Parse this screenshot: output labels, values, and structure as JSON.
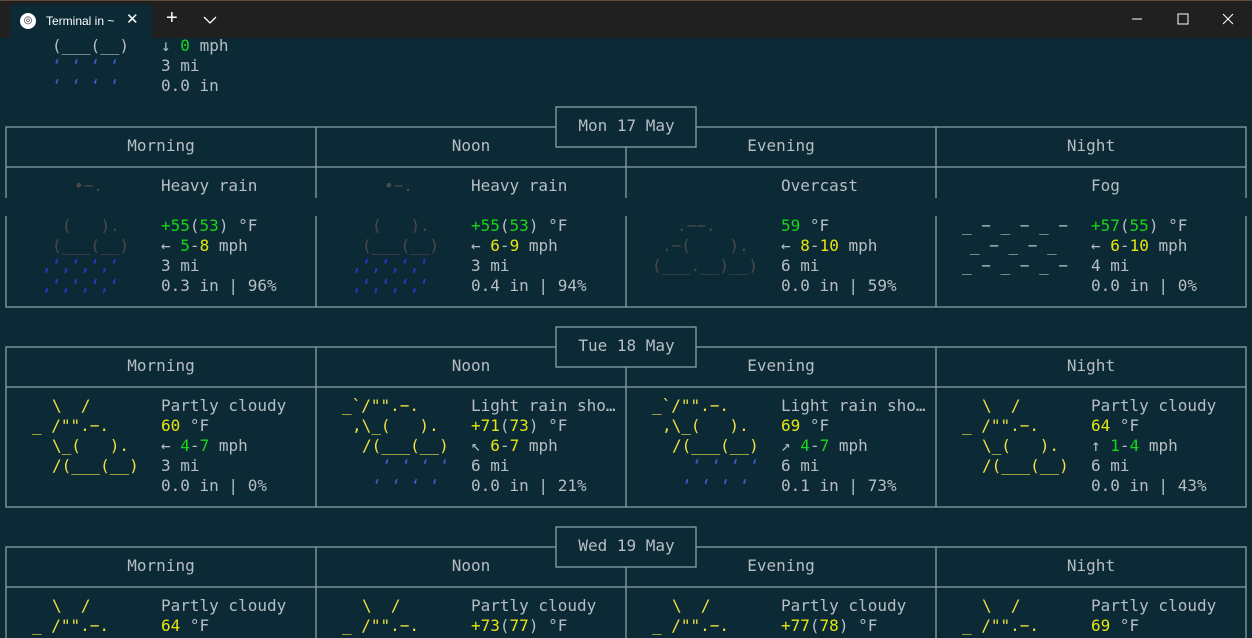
{
  "tab": {
    "title": "Terminal in ~",
    "icon": "tux-icon"
  },
  "top": {
    "art": [
      "(___(__)",
      "‘ ‘ ‘ ‘",
      "‘ ‘ ‘ ‘"
    ],
    "wind_arrow": "↓",
    "wind_speed": "0",
    "wind_unit": "mph",
    "visibility": "3 mi",
    "precip": "0.0 in"
  },
  "days": [
    {
      "date": "Mon 17 May",
      "periods": [
        {
          "name": "Morning",
          "condition": "Heavy rain",
          "art": [
            "•−.",
            "(   ).",
            "(___(__)",
            "‚ʻ‚ʻ‚ʻ‚ʻ",
            "‚ʻ‚ʻ‚ʻ‚ʻ"
          ],
          "temp": "+55",
          "temp2": "53",
          "temp_unit": "°F",
          "wind_arrow": "←",
          "wind_from": "5",
          "wind_to": "8",
          "wind_unit": "mph",
          "visibility": "3 mi",
          "precip": "0.3 in | 96%"
        },
        {
          "name": "Noon",
          "condition": "Heavy rain",
          "art": [
            "•−.",
            "(   ).",
            "(___(__)",
            "‚ʻ‚ʻ‚ʻ‚ʻ",
            "‚ʻ‚ʻ‚ʻ‚ʻ"
          ],
          "temp": "+55",
          "temp2": "53",
          "temp_unit": "°F",
          "wind_arrow": "←",
          "wind_from": "6",
          "wind_to": "9",
          "wind_unit": "mph",
          "visibility": "3 mi",
          "precip": "0.4 in | 94%"
        },
        {
          "name": "Evening",
          "condition": "Overcast",
          "art": [
            "",
            ".−−.",
            ".−(    ).",
            "(___.__)__)"
          ],
          "temp": "59",
          "temp2": "",
          "temp_unit": "°F",
          "wind_arrow": "←",
          "wind_from": "8",
          "wind_to": "10",
          "wind_unit": "mph",
          "visibility": "6 mi",
          "precip": "0.0 in | 59%"
        },
        {
          "name": "Night",
          "condition": "Fog",
          "art": [
            "_ − _ − _ −",
            "_ − _ − _",
            "_ − _ − _ −"
          ],
          "temp": "+57",
          "temp2": "55",
          "temp_unit": "°F",
          "wind_arrow": "←",
          "wind_from": "6",
          "wind_to": "10",
          "wind_unit": "mph",
          "visibility": "4 mi",
          "precip": "0.0 in | 0%"
        }
      ]
    },
    {
      "date": "Tue 18 May",
      "periods": [
        {
          "name": "Morning",
          "condition": "Partly cloudy",
          "art": [
            "\\  /",
            "_ /\"\".−.",
            "\\_(   ).",
            "/(___(__)"
          ],
          "temp": "60",
          "temp2": "",
          "temp_unit": "°F",
          "wind_arrow": "←",
          "wind_from": "4",
          "wind_to": "7",
          "wind_unit": "mph",
          "visibility": "3 mi",
          "precip": "0.0 in | 0%"
        },
        {
          "name": "Noon",
          "condition": "Light rain sho…",
          "art": [
            "_`/\"\".−.",
            ",\\_(   ).",
            "/(___(__)",
            "‘ ‘ ‘ ‘",
            "‘ ‘ ‘ ‘"
          ],
          "temp": "+71",
          "temp2": "73",
          "temp_unit": "°F",
          "wind_arrow": "↖",
          "wind_from": "6",
          "wind_to": "7",
          "wind_unit": "mph",
          "visibility": "6 mi",
          "precip": "0.0 in | 21%"
        },
        {
          "name": "Evening",
          "condition": "Light rain sho…",
          "art": [
            "_`/\"\".−.",
            ",\\_(   ).",
            "/(___(__)",
            "‘ ‘ ‘ ‘",
            "‘ ‘ ‘ ‘"
          ],
          "temp": "69",
          "temp2": "",
          "temp_unit": "°F",
          "wind_arrow": "↗",
          "wind_from": "4",
          "wind_to": "7",
          "wind_unit": "mph",
          "visibility": "6 mi",
          "precip": "0.1 in | 73%"
        },
        {
          "name": "Night",
          "condition": "Partly cloudy",
          "art": [
            "\\  /",
            "_ /\"\".−.",
            "\\_(   ).",
            "/(___(__)"
          ],
          "temp": "64",
          "temp2": "",
          "temp_unit": "°F",
          "wind_arrow": "↑",
          "wind_from": "1",
          "wind_to": "4",
          "wind_unit": "mph",
          "visibility": "6 mi",
          "precip": "0.0 in | 43%"
        }
      ]
    },
    {
      "date": "Wed 19 May",
      "periods": [
        {
          "name": "Morning",
          "condition": "Partly cloudy",
          "art": [
            "\\  /",
            "_ /\"\".−."
          ],
          "temp": "64",
          "temp2": "",
          "temp_unit": "°F"
        },
        {
          "name": "Noon",
          "condition": "Partly cloudy",
          "art": [
            "\\  /",
            "_ /\"\".−."
          ],
          "temp": "+73",
          "temp2": "77",
          "temp_unit": "°F"
        },
        {
          "name": "Evening",
          "condition": "Partly cloudy",
          "art": [
            "\\  /",
            "_ /\"\".−."
          ],
          "temp": "+77",
          "temp2": "78",
          "temp_unit": "°F"
        },
        {
          "name": "Night",
          "condition": "Partly cloudy",
          "art": [
            "\\  /",
            "_ /\"\".−."
          ],
          "temp": "69",
          "temp2": "",
          "temp_unit": "°F"
        }
      ]
    }
  ],
  "colors": {
    "background": "#0c2a35",
    "titlebar": "#202020",
    "text": "#b6bec4",
    "green": "#16d816",
    "yellow": "#e5e510",
    "rain": "#3860d8",
    "border": "#8aa0a8"
  }
}
